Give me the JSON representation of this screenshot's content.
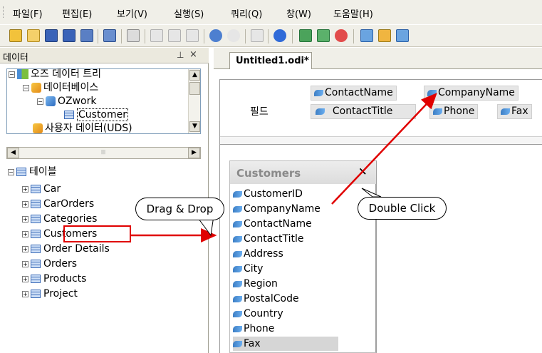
{
  "menu": [
    "파일(F)",
    "편집(E)",
    "보기(V)",
    "실행(S)",
    "쿼리(Q)",
    "창(W)",
    "도움말(H)"
  ],
  "data_panel": {
    "title": "데이터",
    "tree": {
      "root": "오즈 데이터 트리",
      "database": "데이터베이스",
      "project": "OZwork",
      "set": "Customer",
      "uds": "사용자 데이터(UDS)"
    }
  },
  "tables": {
    "root": "테이블",
    "items": [
      "Car",
      "CarOrders",
      "Categories",
      "Customers",
      "Order Details",
      "Orders",
      "Products",
      "Project"
    ]
  },
  "document_tab": "Untitled1.odi*",
  "fields": {
    "label": "필드",
    "chips": [
      "ContactName",
      "CompanyName",
      "ContactTitle",
      "Phone",
      "Fax"
    ]
  },
  "customers_box": {
    "title": "Customers",
    "close": "×",
    "fields": [
      "CustomerID",
      "CompanyName",
      "ContactName",
      "ContactTitle",
      "Address",
      "City",
      "Region",
      "PostalCode",
      "Country",
      "Phone",
      "Fax"
    ]
  },
  "callouts": {
    "drag": "Drag & Drop",
    "double_click": "Double Click"
  }
}
